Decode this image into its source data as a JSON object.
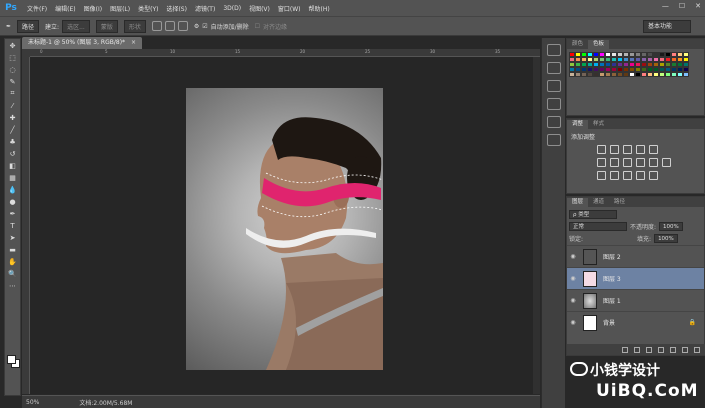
{
  "app": {
    "logo": "Ps"
  },
  "menu": [
    "文件(F)",
    "编辑(E)",
    "图像(I)",
    "图层(L)",
    "类型(Y)",
    "选择(S)",
    "滤镜(T)",
    "3D(D)",
    "视图(V)",
    "窗口(W)",
    "帮助(H)"
  ],
  "window_controls": [
    "—",
    "☐",
    "✕"
  ],
  "options": {
    "mode": "路径",
    "make_label": "建立:",
    "selection_btn": "选区...",
    "mask_btn": "蒙版",
    "shape_btn": "形状",
    "auto_add": "自动添加/删除",
    "align_edges": "对齐边缘",
    "workspace": "基本功能"
  },
  "document_tab": {
    "title": "未标题-1 @ 50% (图层 3, RGB/8)",
    "modified": "*",
    "close": "×"
  },
  "ruler_ticks": [
    "0",
    "5",
    "10",
    "15",
    "20",
    "25",
    "30",
    "35"
  ],
  "status": {
    "zoom": "50%",
    "doc": "文档:2.00M/5.68M"
  },
  "swatches_panel": {
    "tabs": [
      "颜色",
      "色板"
    ],
    "active": 1
  },
  "swatch_colors": [
    "#ff0000",
    "#ffff00",
    "#00ff00",
    "#00ffff",
    "#0000ff",
    "#ff00ff",
    "#ffffff",
    "#e6e6e6",
    "#cccccc",
    "#b3b3b3",
    "#999999",
    "#808080",
    "#666666",
    "#4d4d4d",
    "#333333",
    "#1a1a1a",
    "#000000",
    "#ff8080",
    "#ffcc80",
    "#ffff80",
    "#f26d7d",
    "#f68e56",
    "#fbaf5d",
    "#fff799",
    "#acd372",
    "#7cc576",
    "#3bb878",
    "#1abbb4",
    "#00bff3",
    "#438ccb",
    "#5574b9",
    "#605ca8",
    "#855fa8",
    "#a763a8",
    "#f06ea9",
    "#f26c7d",
    "#ed1c24",
    "#f26522",
    "#f7941d",
    "#fff200",
    "#8dc63f",
    "#39b54a",
    "#00a651",
    "#00a99d",
    "#00aeef",
    "#0072bc",
    "#0054a6",
    "#2e3192",
    "#662d91",
    "#92278f",
    "#ec008c",
    "#ed145b",
    "#9e0b0f",
    "#a0410d",
    "#a3620a",
    "#aba000",
    "#598527",
    "#197b30",
    "#007236",
    "#00746b",
    "#0076a3",
    "#004a80",
    "#003471",
    "#1b1464",
    "#440e62",
    "#630460",
    "#9e005d",
    "#9e0039",
    "#790000",
    "#7b2e00",
    "#7d4900",
    "#827b00",
    "#406618",
    "#005e20",
    "#005826",
    "#005952",
    "#005b7f",
    "#003663",
    "#002157",
    "#0d004c",
    "#c7b299",
    "#998675",
    "#736357",
    "#534741",
    "#37302d",
    "#c69c6d",
    "#a67c52",
    "#8c6239",
    "#754c24",
    "#603913",
    "#ffffff",
    "#000000",
    "#ff7f7f",
    "#ffbf7f",
    "#ffff7f",
    "#bfff7f",
    "#7fff7f",
    "#7fffbf",
    "#7fffff",
    "#7fbfff"
  ],
  "adjustments_panel": {
    "tabs": [
      "调整",
      "样式"
    ],
    "title": "添加调整"
  },
  "layers_panel": {
    "tabs": [
      "图层",
      "通道",
      "路径"
    ],
    "kind": "ρ 类型",
    "blend": "正常",
    "opacity_label": "不透明度:",
    "opacity": "100%",
    "lock_label": "锁定:",
    "fill_label": "填充:",
    "fill": "100%",
    "layers": [
      {
        "name": "图层 2",
        "active": false
      },
      {
        "name": "图层 3",
        "active": true
      },
      {
        "name": "图层 1",
        "active": false
      },
      {
        "name": "背景",
        "active": false,
        "locked": "🔒"
      }
    ]
  },
  "watermark": {
    "line1": "小钱学设计",
    "line2": "UiBQ.CoM"
  }
}
